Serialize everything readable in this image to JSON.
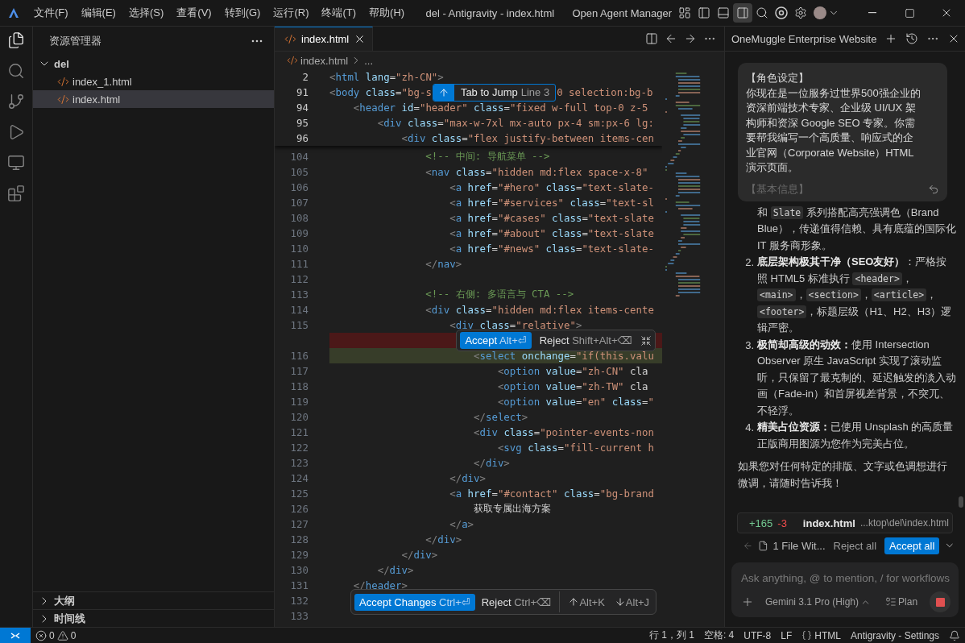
{
  "title_bar": {
    "menus": [
      "文件(F)",
      "编辑(E)",
      "选择(S)",
      "查看(V)",
      "转到(G)",
      "运行(R)",
      "终端(T)",
      "帮助(H)"
    ],
    "title": "del - Antigravity - index.html",
    "agent_manager": "Open Agent Manager",
    "layout_buttons": [
      {
        "kind": "custom",
        "selected": false
      },
      {
        "kind": "left",
        "selected": false
      },
      {
        "kind": "bottom",
        "selected": false
      },
      {
        "kind": "right",
        "selected": true
      }
    ]
  },
  "activity_bar": [
    {
      "kind": "explorer",
      "selected": true
    },
    {
      "kind": "search",
      "selected": false
    },
    {
      "kind": "source-control",
      "selected": false
    },
    {
      "kind": "run",
      "selected": false
    },
    {
      "kind": "remote",
      "selected": false
    },
    {
      "kind": "extensions",
      "selected": false
    }
  ],
  "sidebar": {
    "title": "资源管理器",
    "tree": [
      {
        "label": "del",
        "expanded": true,
        "children": [
          {
            "label": "index_1.html",
            "selected": false
          },
          {
            "label": "index.html",
            "selected": true
          }
        ]
      }
    ],
    "sections": [
      {
        "label": "大纲",
        "expanded": false
      },
      {
        "label": "时间线",
        "expanded": false
      }
    ]
  },
  "editor": {
    "tabs": [
      {
        "label": "index.html",
        "selected": true
      }
    ],
    "breadcrumb": [
      "index.html",
      "..."
    ],
    "sticky_lines": [
      {
        "num": "2",
        "text": "<html lang=\"zh-CN\">"
      },
      {
        "num": "91",
        "text": "<body class=\"bg-s",
        "jump_hint": {
          "label": "Tab to Jump",
          "target": "Line 3"
        },
        "tail": "0 selection:bg-b"
      },
      {
        "num": "94",
        "text": "    <header id=\"header\" class=\"fixed w-full top-0 z-5"
      },
      {
        "num": "95",
        "text": "        <div class=\"max-w-7xl mx-auto px-4 sm:px-6 lg:"
      },
      {
        "num": "96",
        "text": "            <div class=\"flex justify-between items-cen"
      }
    ],
    "lines": [
      {
        "kind": "normal",
        "num": "104",
        "text": "                <!-- 中间: 导航菜单 -->"
      },
      {
        "kind": "normal",
        "num": "105",
        "text": "                <nav class=\"hidden md:flex space-x-8\""
      },
      {
        "kind": "normal",
        "num": "106",
        "text": "                    <a href=\"#hero\" class=\"text-slate-"
      },
      {
        "kind": "normal",
        "num": "107",
        "text": "                    <a href=\"#services\" class=\"text-sl"
      },
      {
        "kind": "normal",
        "num": "108",
        "text": "                    <a href=\"#cases\" class=\"text-slate"
      },
      {
        "kind": "normal",
        "num": "109",
        "text": "                    <a href=\"#about\" class=\"text-slate"
      },
      {
        "kind": "normal",
        "num": "110",
        "text": "                    <a href=\"#news\" class=\"text-slate-"
      },
      {
        "kind": "normal",
        "num": "111",
        "text": "                </nav>"
      },
      {
        "kind": "normal",
        "num": "112"
      },
      {
        "kind": "normal",
        "num": "113",
        "text": "                <!-- 右侧: 多语言与 CTA -->"
      },
      {
        "kind": "normal",
        "num": "114",
        "text": "                <div class=\"hidden md:flex items-cente"
      },
      {
        "kind": "normal",
        "num": "115",
        "text": "                    <div class=\"relative\">"
      },
      {
        "kind": "deleted",
        "review": {
          "accept": "Accept",
          "accept_keys": "Alt+⏎",
          "reject": "Reject",
          "reject_keys": "Shift+Alt+⌫"
        }
      },
      {
        "kind": "added",
        "num": "116",
        "text": "                        <select onchange=\"if(this.valu"
      },
      {
        "kind": "normal",
        "num": "117",
        "text": "                            <option value=\"zh-CN\" cla"
      },
      {
        "kind": "normal",
        "num": "118",
        "text": "                            <option value=\"zh-TW\" cla"
      },
      {
        "kind": "normal",
        "num": "119",
        "text": "                            <option value=\"en\" class=\""
      },
      {
        "kind": "normal",
        "num": "120",
        "text": "                        </select>"
      },
      {
        "kind": "normal",
        "num": "121",
        "text": "                        <div class=\"pointer-events-non"
      },
      {
        "kind": "normal",
        "num": "122",
        "text": "                            <svg class=\"fill-current h"
      },
      {
        "kind": "normal",
        "num": "123",
        "text": "                        </div>"
      },
      {
        "kind": "normal",
        "num": "124",
        "text": "                    </div>"
      },
      {
        "kind": "normal",
        "num": "125",
        "text": "                    <a href=\"#contact\" class=\"bg-brand"
      },
      {
        "kind": "normal",
        "num": "126",
        "text": "                        获取专属出海方案"
      },
      {
        "kind": "normal",
        "num": "127",
        "text": "                    </a>"
      },
      {
        "kind": "normal",
        "num": "128",
        "text": "                </div>"
      },
      {
        "kind": "normal",
        "num": "129",
        "text": "            </div>"
      },
      {
        "kind": "normal",
        "num": "130",
        "text": "        </div>"
      },
      {
        "kind": "normal",
        "num": "131",
        "text": "    </header>"
      },
      {
        "kind": "normal",
        "num": "132"
      },
      {
        "kind": "normal",
        "num": "133"
      }
    ],
    "review_bar": {
      "accept": "Accept Changes",
      "accept_keys": "Ctrl+⏎",
      "reject": "Reject",
      "reject_keys": "Ctrl+⌫",
      "prev_keys": "Alt+K",
      "next_keys": "Alt+J"
    }
  },
  "chat": {
    "title": "OneMuggle Enterprise Website",
    "prompt": {
      "heading": "【角色设定】",
      "text": "你现在是一位服务过世界500强企业的资深前端技术专家、企业级 UI/UX 架构师和资深 Google SEO 专家。你需要帮我编写一个高质量、响应式的企业官网（Corporate Website）HTML 演示页面。",
      "more": "【基本信息】"
    },
    "response": [
      {
        "segments": [
          {
            "kind": "text",
            "text": "和 "
          },
          {
            "kind": "code",
            "text": "Slate"
          },
          {
            "kind": "text",
            "text": " 系列搭配高亮强调色（Brand Blue），传递值得信赖、具有底蕴的国际化 IT 服务商形象。"
          }
        ]
      },
      {
        "number": "2.",
        "segments": [
          {
            "kind": "bold",
            "text": "底层架构极其干净（SEO友好）"
          },
          {
            "kind": "text",
            "text": "：严格按照 HTML5 标准执行 "
          },
          {
            "kind": "code",
            "text": "<header>"
          },
          {
            "kind": "text",
            "text": "，"
          },
          {
            "kind": "code",
            "text": "<main>"
          },
          {
            "kind": "text",
            "text": "，"
          },
          {
            "kind": "code",
            "text": "<section>"
          },
          {
            "kind": "text",
            "text": "，"
          },
          {
            "kind": "code",
            "text": "<article>"
          },
          {
            "kind": "text",
            "text": "，"
          },
          {
            "kind": "code",
            "text": "<footer>"
          },
          {
            "kind": "text",
            "text": "，标题层级（H1、H2、H3）逻辑严密。"
          }
        ]
      },
      {
        "number": "3.",
        "segments": [
          {
            "kind": "bold",
            "text": "极简却高级的动效："
          },
          {
            "kind": "text",
            "text": "使用 Intersection Observer 原生 JavaScript 实现了滚动监听，只保留了最克制的、延迟触发的淡入动画（Fade-in）和首屏视差背景，不突兀、不轻浮。"
          }
        ]
      },
      {
        "number": "4.",
        "segments": [
          {
            "kind": "bold",
            "text": "精美占位资源："
          },
          {
            "kind": "text",
            "text": "已使用 Unsplash 的高质量正版商用图源为您作为完美占位。"
          }
        ]
      }
    ],
    "closing": "如果您对任何特定的排版、文字或色调想进行微调，请随时告诉我！",
    "file_change": {
      "added": "+165",
      "removed": "-3",
      "file": "index.html",
      "path": "...ktop\\del\\index.html"
    },
    "review": {
      "summary": "1 File Wit...",
      "reject": "Reject all",
      "accept": "Accept all"
    },
    "input": {
      "placeholder": "Ask anything, @ to mention, / for workflows",
      "model": "Gemini 3.1 Pro (High)",
      "mode": "Plan"
    }
  },
  "status_bar": {
    "errors": "0",
    "warnings": "0",
    "items": [
      "行 1，列 1",
      "空格: 4",
      "UTF-8",
      "LF"
    ],
    "language": "HTML",
    "settings": "Antigravity - Settings"
  }
}
